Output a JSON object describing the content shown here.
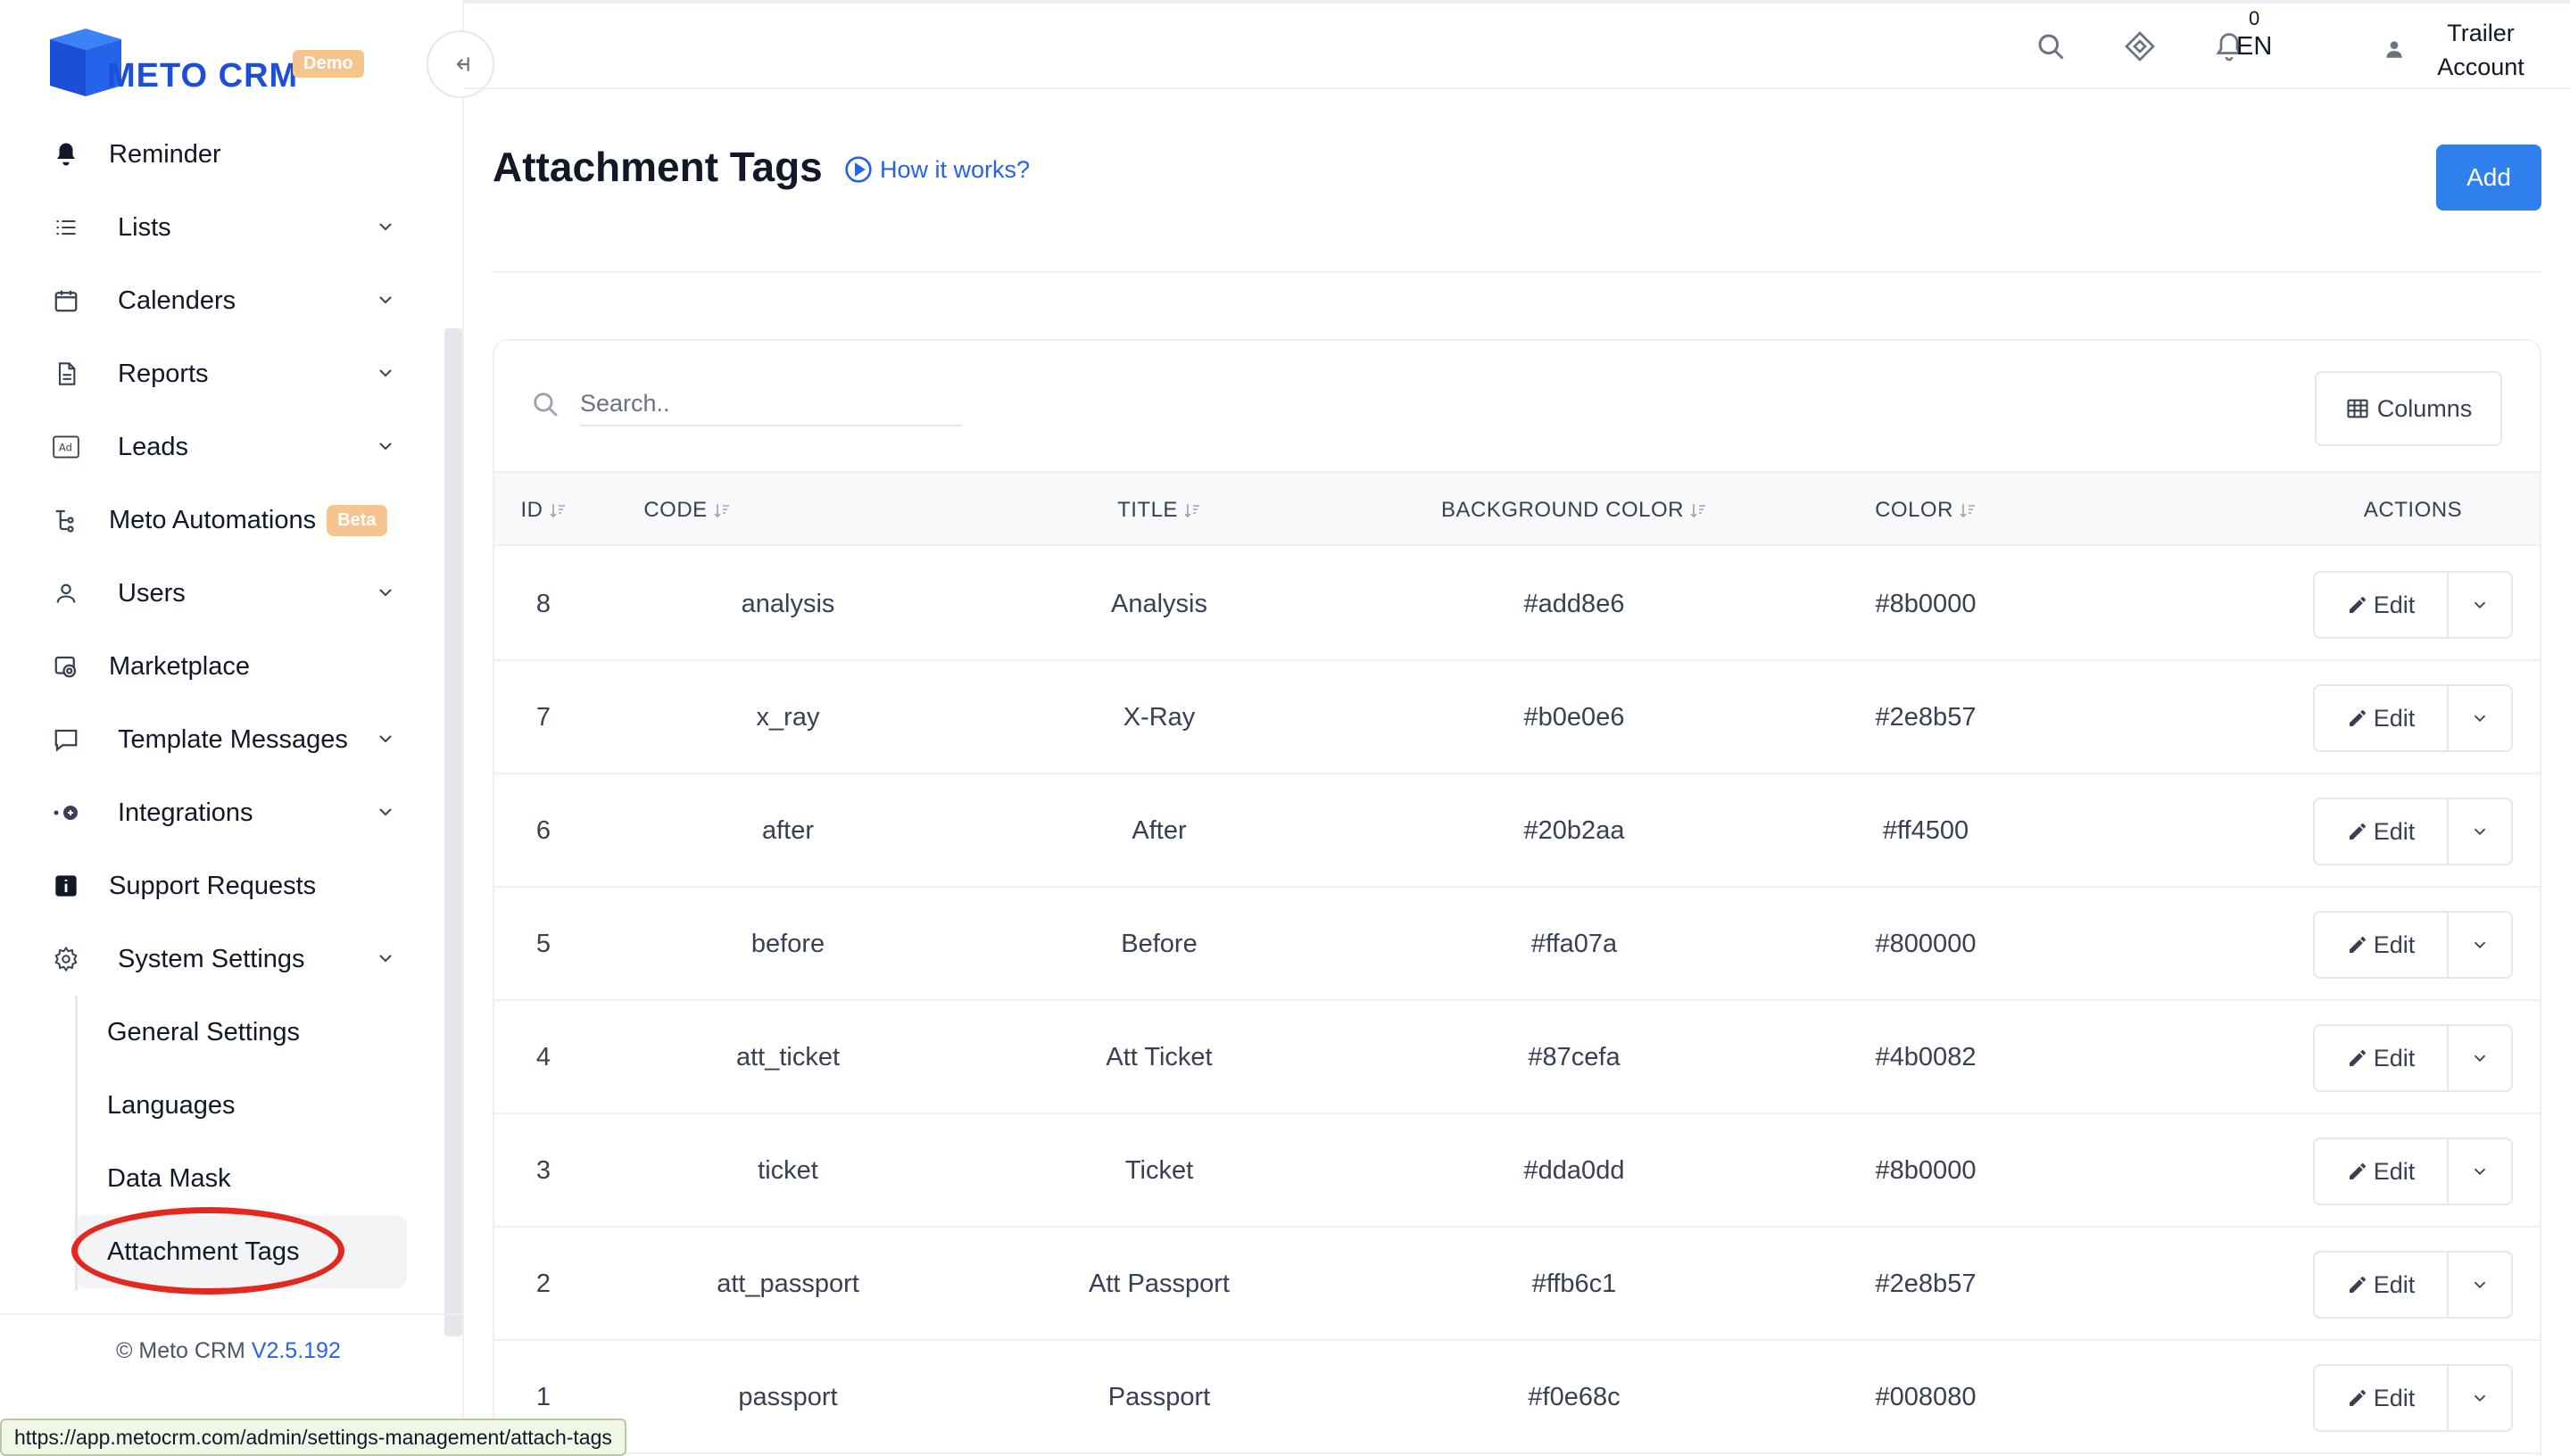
{
  "brand": {
    "name": "METO CRM",
    "badge": "Demo"
  },
  "sidebar": {
    "items": [
      {
        "label": "Reminder",
        "icon": "bell-icon",
        "has_chevron": false
      },
      {
        "label": "Lists",
        "icon": "list-icon",
        "has_chevron": true
      },
      {
        "label": "Calenders",
        "icon": "calendar-icon",
        "has_chevron": true
      },
      {
        "label": "Reports",
        "icon": "report-icon",
        "has_chevron": true
      },
      {
        "label": "Leads",
        "icon": "ad-icon",
        "has_chevron": true
      },
      {
        "label": "Meto Automations",
        "icon": "automation-icon",
        "has_chevron": false,
        "badge": "Beta"
      },
      {
        "label": "Users",
        "icon": "user-icon",
        "has_chevron": true
      },
      {
        "label": "Marketplace",
        "icon": "marketplace-icon",
        "has_chevron": false
      },
      {
        "label": "Template Messages",
        "icon": "message-icon",
        "has_chevron": true
      },
      {
        "label": "Integrations",
        "icon": "integration-icon",
        "has_chevron": true
      },
      {
        "label": "Support Requests",
        "icon": "info-icon",
        "has_chevron": false
      },
      {
        "label": "System Settings",
        "icon": "gear-icon",
        "has_chevron": true
      }
    ],
    "sub_items": [
      {
        "label": "General Settings"
      },
      {
        "label": "Languages"
      },
      {
        "label": "Data Mask"
      },
      {
        "label": "Attachment Tags",
        "active": true
      }
    ],
    "footer": {
      "copyright": "© Meto CRM",
      "version": "V2.5.192"
    }
  },
  "header": {
    "notification_count": "0",
    "language": "EN",
    "user_line1": "Trailer",
    "user_line2": "Account"
  },
  "page": {
    "title": "Attachment Tags",
    "how_it_works": "How it works?",
    "add_label": "Add"
  },
  "table": {
    "search_placeholder": "Search..",
    "columns_label": "Columns",
    "headers": [
      "ID",
      "CODE",
      "TITLE",
      "BACKGROUND COLOR",
      "COLOR",
      "ACTIONS"
    ],
    "edit_label": "Edit",
    "rows": [
      {
        "id": "8",
        "code": "analysis",
        "title": "Analysis",
        "bg": "#add8e6",
        "color": "#8b0000"
      },
      {
        "id": "7",
        "code": "x_ray",
        "title": "X-Ray",
        "bg": "#b0e0e6",
        "color": "#2e8b57"
      },
      {
        "id": "6",
        "code": "after",
        "title": "After",
        "bg": "#20b2aa",
        "color": "#ff4500"
      },
      {
        "id": "5",
        "code": "before",
        "title": "Before",
        "bg": "#ffa07a",
        "color": "#800000"
      },
      {
        "id": "4",
        "code": "att_ticket",
        "title": "Att Ticket",
        "bg": "#87cefa",
        "color": "#4b0082"
      },
      {
        "id": "3",
        "code": "ticket",
        "title": "Ticket",
        "bg": "#dda0dd",
        "color": "#8b0000"
      },
      {
        "id": "2",
        "code": "att_passport",
        "title": "Att Passport",
        "bg": "#ffb6c1",
        "color": "#2e8b57"
      },
      {
        "id": "1",
        "code": "passport",
        "title": "Passport",
        "bg": "#f0e68c",
        "color": "#008080"
      }
    ]
  },
  "status_bar": {
    "url": "https://app.metocrm.com/admin/settings-management/attach-tags"
  },
  "colors": {
    "accent": "#2f80ed",
    "brand": "#1d4ed8",
    "badge": "#f6c58f",
    "highlight_ring": "#e5281f"
  }
}
